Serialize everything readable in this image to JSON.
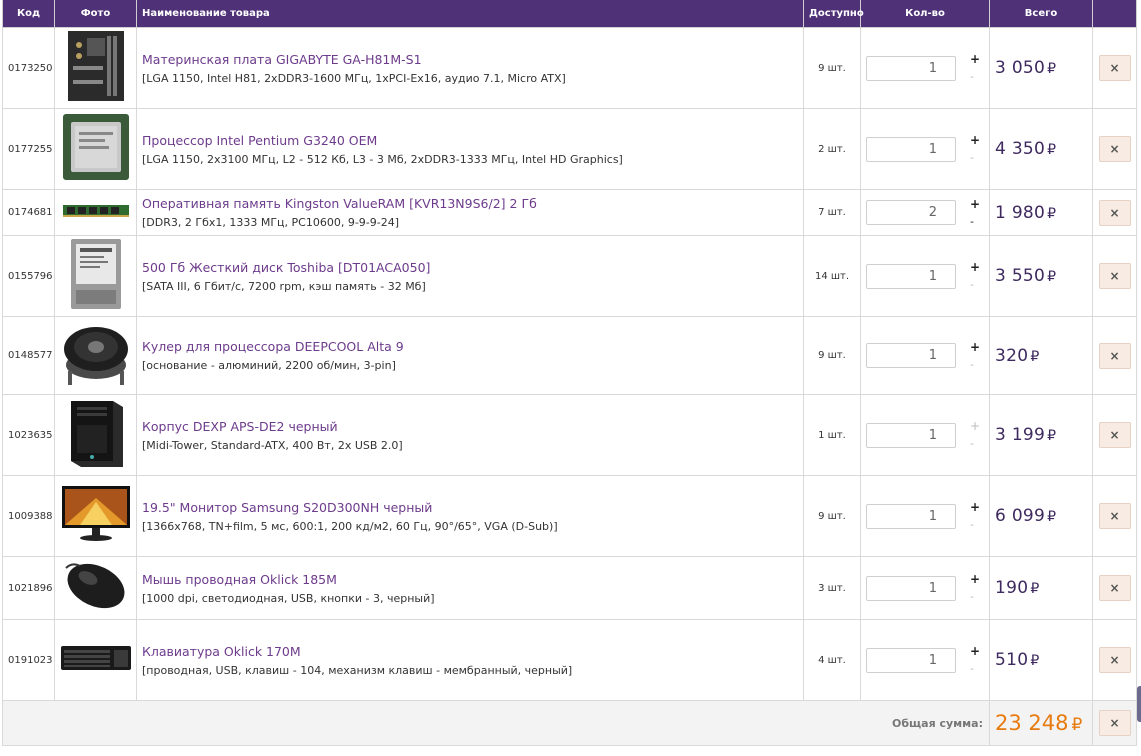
{
  "headers": {
    "code": "Код",
    "photo": "Фото",
    "name": "Наименование товара",
    "avail": "Доступно",
    "qty": "Кол-во",
    "total": "Всего"
  },
  "currency": "₽",
  "items": [
    {
      "code": "0173250",
      "title": "Материнская плата GIGABYTE GA-H81M-S1",
      "spec": "[LGA 1150, Intel H81, 2xDDR3-1600 МГц, 1xPCI-Ex16, аудио 7.1, Micro ATX]",
      "avail": "9 шт.",
      "qty": "1",
      "plus": "+",
      "minus": "-",
      "total": "3 050",
      "delete": "×"
    },
    {
      "code": "0177255",
      "title": "Процессор Intel Pentium G3240 OEM",
      "spec": "[LGA 1150, 2x3100 МГц, L2 - 512 Кб, L3 - 3 Мб, 2xDDR3-1333 МГц, Intel HD Graphics]",
      "avail": "2 шт.",
      "qty": "1",
      "plus": "+",
      "minus": "-",
      "total": "4 350",
      "delete": "×"
    },
    {
      "code": "0174681",
      "title": "Оперативная память Kingston ValueRAM [KVR13N9S6/2] 2 Гб",
      "spec": "[DDR3, 2 Гбх1, 1333 МГц, PC10600, 9-9-9-24]",
      "avail": "7 шт.",
      "qty": "2",
      "plus": "+",
      "minus": "-",
      "total": "1 980",
      "delete": "×"
    },
    {
      "code": "0155796",
      "title": "500 Гб Жесткий диск Toshiba [DT01ACA050]",
      "spec": "[SATA III, 6 Гбит/с, 7200 rpm, кэш память - 32 Мб]",
      "avail": "14 шт.",
      "qty": "1",
      "plus": "+",
      "minus": "-",
      "total": "3 550",
      "delete": "×"
    },
    {
      "code": "0148577",
      "title": "Кулер для процессора DEEPCOOL Alta 9",
      "spec": "[основание - алюминий, 2200 об/мин, 3-pin]",
      "avail": "9 шт.",
      "qty": "1",
      "plus": "+",
      "minus": "-",
      "total": "320",
      "delete": "×"
    },
    {
      "code": "1023635",
      "title": "Корпус DEXP APS-DE2 черный",
      "spec": "[Midi-Tower, Standard-ATX, 400 Вт, 2x USB 2.0]",
      "avail": "1 шт.",
      "qty": "1",
      "plus": "+",
      "minus": "-",
      "total": "3 199",
      "delete": "×"
    },
    {
      "code": "1009388",
      "title": "19.5\" Монитор Samsung S20D300NH черный",
      "spec": "[1366x768, TN+film, 5 мс, 600:1, 200 кд/м2, 60 Гц, 90°/65°, VGA (D-Sub)]",
      "avail": "9 шт.",
      "qty": "1",
      "plus": "+",
      "minus": "-",
      "total": "6 099",
      "delete": "×"
    },
    {
      "code": "1021896",
      "title": "Мышь проводная Oklick 185M",
      "spec": "[1000 dpi, светодиодная, USB, кнопки - 3, черный]",
      "avail": "3 шт.",
      "qty": "1",
      "plus": "+",
      "minus": "-",
      "total": "190",
      "delete": "×"
    },
    {
      "code": "0191023",
      "title": "Клавиатура Oklick 170M",
      "spec": "[проводная, USB, клавиш - 104, механизм клавиш - мембранный, черный]",
      "avail": "4 шт.",
      "qty": "1",
      "plus": "+",
      "minus": "-",
      "total": "510",
      "delete": "×"
    }
  ],
  "summary": {
    "label": "Общая сумма:",
    "total": "23 248",
    "delete": "×"
  },
  "colors": {
    "header_bg": "#4f3178",
    "link": "#6d3b8c",
    "sum": "#e87b10",
    "price": "#3e2a5f"
  }
}
